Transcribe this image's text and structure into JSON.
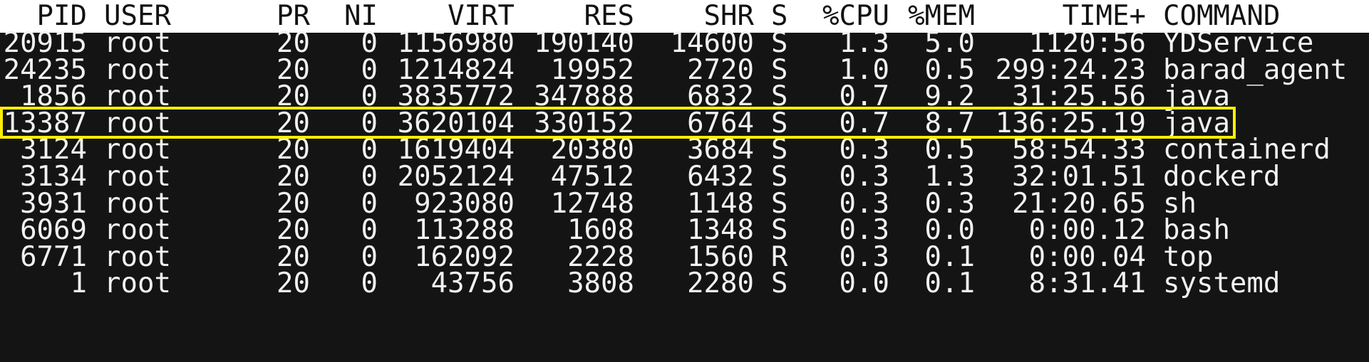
{
  "header": {
    "pid": "PID",
    "user": "USER",
    "pr": "PR",
    "ni": "NI",
    "virt": "VIRT",
    "res": "RES",
    "shr": "SHR",
    "s": "S",
    "cpu": "%CPU",
    "mem": "%MEM",
    "time": "TIME+",
    "command": "COMMAND"
  },
  "processes": [
    {
      "pid": "20915",
      "user": "root",
      "pr": "20",
      "ni": "0",
      "virt": "1156980",
      "res": "190140",
      "shr": "14600",
      "s": "S",
      "cpu": "1.3",
      "mem": "5.0",
      "time": "1120:56",
      "command": "YDService"
    },
    {
      "pid": "24235",
      "user": "root",
      "pr": "20",
      "ni": "0",
      "virt": "1214824",
      "res": "19952",
      "shr": "2720",
      "s": "S",
      "cpu": "1.0",
      "mem": "0.5",
      "time": "299:24.23",
      "command": "barad_agent"
    },
    {
      "pid": "1856",
      "user": "root",
      "pr": "20",
      "ni": "0",
      "virt": "3835772",
      "res": "347888",
      "shr": "6832",
      "s": "S",
      "cpu": "0.7",
      "mem": "9.2",
      "time": "31:25.56",
      "command": "java"
    },
    {
      "pid": "13387",
      "user": "root",
      "pr": "20",
      "ni": "0",
      "virt": "3620104",
      "res": "330152",
      "shr": "6764",
      "s": "S",
      "cpu": "0.7",
      "mem": "8.7",
      "time": "136:25.19",
      "command": "java"
    },
    {
      "pid": "3124",
      "user": "root",
      "pr": "20",
      "ni": "0",
      "virt": "1619404",
      "res": "20380",
      "shr": "3684",
      "s": "S",
      "cpu": "0.3",
      "mem": "0.5",
      "time": "58:54.33",
      "command": "containerd"
    },
    {
      "pid": "3134",
      "user": "root",
      "pr": "20",
      "ni": "0",
      "virt": "2052124",
      "res": "47512",
      "shr": "6432",
      "s": "S",
      "cpu": "0.3",
      "mem": "1.3",
      "time": "32:01.51",
      "command": "dockerd"
    },
    {
      "pid": "3931",
      "user": "root",
      "pr": "20",
      "ni": "0",
      "virt": "923080",
      "res": "12748",
      "shr": "1148",
      "s": "S",
      "cpu": "0.3",
      "mem": "0.3",
      "time": "21:20.65",
      "command": "sh"
    },
    {
      "pid": "6069",
      "user": "root",
      "pr": "20",
      "ni": "0",
      "virt": "113288",
      "res": "1608",
      "shr": "1348",
      "s": "S",
      "cpu": "0.3",
      "mem": "0.0",
      "time": "0:00.12",
      "command": "bash"
    },
    {
      "pid": "6771",
      "user": "root",
      "pr": "20",
      "ni": "0",
      "virt": "162092",
      "res": "2228",
      "shr": "1560",
      "s": "R",
      "cpu": "0.3",
      "mem": "0.1",
      "time": "0:00.04",
      "command": "top"
    },
    {
      "pid": "1",
      "user": "root",
      "pr": "20",
      "ni": "0",
      "virt": "43756",
      "res": "3808",
      "shr": "2280",
      "s": "S",
      "cpu": "0.0",
      "mem": "0.1",
      "time": "8:31.41",
      "command": "systemd"
    }
  ],
  "highlighted_row_index": 3,
  "colors": {
    "background": "#141414",
    "foreground": "#f2f2f2",
    "header_background": "#ffffff",
    "header_foreground": "#111111",
    "highlight_border": "#ffef00"
  }
}
